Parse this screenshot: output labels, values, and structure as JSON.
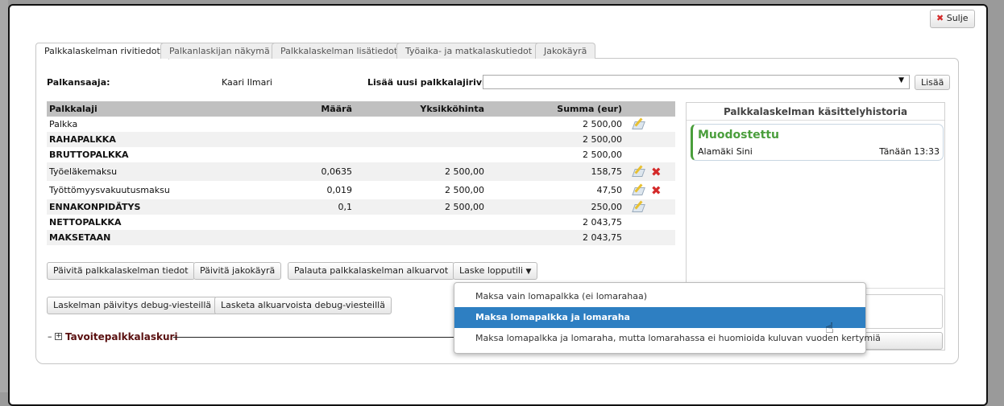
{
  "close_label": "Sulje",
  "tabs": [
    "Palkkalaskelman rivitiedot",
    "Palkanlaskijan näkymä",
    "Palkkalaskelman lisätiedot",
    "Työaika- ja matkalaskutiedot",
    "Jakokäyrä"
  ],
  "recipient": {
    "label": "Palkansaaja:",
    "value": "Kaari Ilmari"
  },
  "add_row": {
    "label": "Lisää uusi palkkalajirivi:",
    "select_value": "",
    "button": "Lisää"
  },
  "table": {
    "headers": [
      "Palkkalaji",
      "Määrä",
      "Yksikköhinta",
      "Summa (eur)"
    ],
    "rows": [
      {
        "name": "Palkka",
        "qty": "",
        "unit": "",
        "sum": "2 500,00",
        "bold": false,
        "edit": true,
        "del": false
      },
      {
        "name": "RAHAPALKKA",
        "qty": "",
        "unit": "",
        "sum": "2 500,00",
        "bold": true,
        "edit": false,
        "del": false
      },
      {
        "name": "BRUTTOPALKKA",
        "qty": "",
        "unit": "",
        "sum": "2 500,00",
        "bold": true,
        "edit": false,
        "del": false
      },
      {
        "name": "Työeläkemaksu",
        "qty": "0,0635",
        "unit": "2 500,00",
        "sum": "158,75",
        "bold": false,
        "edit": true,
        "del": true
      },
      {
        "name": "Työttömyysvakuutusmaksu",
        "qty": "0,019",
        "unit": "2 500,00",
        "sum": "47,50",
        "bold": false,
        "edit": true,
        "del": true
      },
      {
        "name": "ENNAKONPIDÄTYS",
        "qty": "0,1",
        "unit": "2 500,00",
        "sum": "250,00",
        "bold": true,
        "edit": true,
        "del": false
      },
      {
        "name": "NETTOPALKKA",
        "qty": "",
        "unit": "",
        "sum": "2 043,75",
        "bold": true,
        "edit": false,
        "del": false
      },
      {
        "name": "MAKSETAAN",
        "qty": "",
        "unit": "",
        "sum": "2 043,75",
        "bold": true,
        "edit": false,
        "del": false
      }
    ]
  },
  "buttons": {
    "update_details": "Päivitä palkkalaskelman tiedot",
    "update_curve": "Päivitä jakokäyrä",
    "restore": "Palauta palkkalaskelman alkuarvot",
    "final": "Laske lopputili",
    "debug_update": "Laskelman päivitys debug-viesteillä",
    "debug_initial": "Lasketa alkuarvoista debug-viesteillä"
  },
  "target_calc": "Tavoitepalkkalaskuri",
  "history": {
    "title": "Palkkalaskelman käsittelyhistoria",
    "items": [
      {
        "status": "Muodostettu",
        "user": "Alamäki Sini",
        "time": "Tänään 13:33"
      }
    ]
  },
  "dropdown": {
    "items": [
      "Maksa vain lomapalkka (ei lomarahaa)",
      "Maksa lomapalkka ja lomaraha",
      "Maksa lomapalkka ja lomaraha, mutta lomarahassa ei huomioida kuluvan vuoden kertymiä"
    ],
    "selected": 1
  },
  "colors": {
    "accent": "#2e7fc2",
    "status_green": "#4a9e3c",
    "delete_red": "#d42a2a"
  }
}
